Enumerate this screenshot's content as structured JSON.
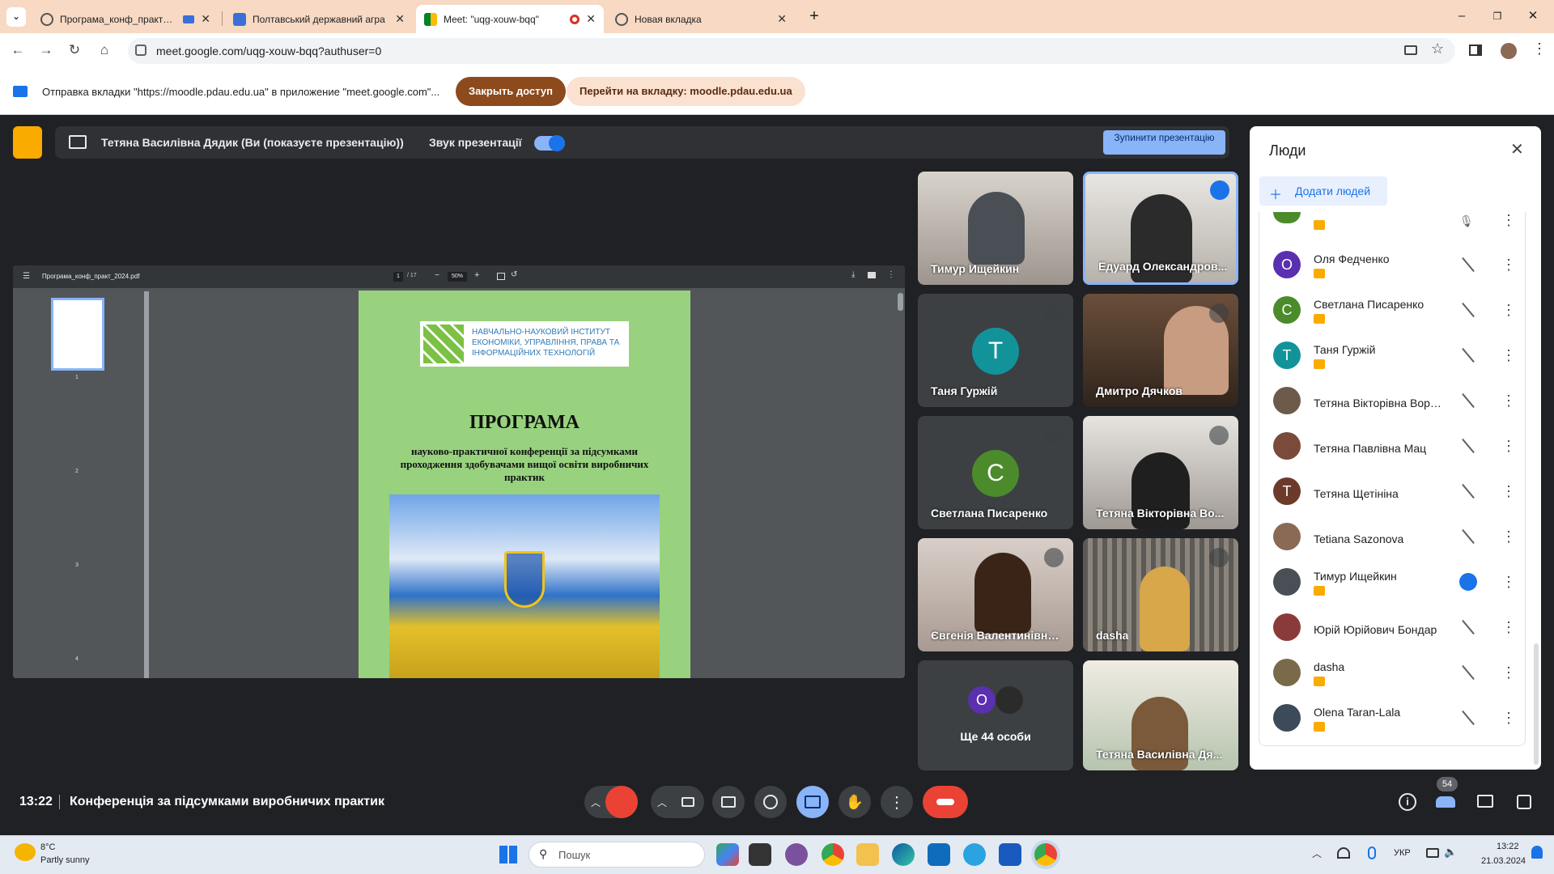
{
  "browser": {
    "tabs": [
      {
        "title": "Програма_конф_практ_20",
        "active": false
      },
      {
        "title": "Полтавський державний агра",
        "active": false
      },
      {
        "title": "Meet: \"uqg-xouw-bqq\"",
        "active": true
      },
      {
        "title": "Новая вкладка",
        "active": false
      }
    ],
    "url": "meet.google.com/uqg-xouw-bqq?authuser=0"
  },
  "infobar": {
    "text": "Отправка вкладки \"https://moodle.pdau.edu.ua\" в приложение \"meet.google.com\"...",
    "stop_label": "Закрыть доступ",
    "goto_label": "Перейти на вкладку: moodle.pdau.edu.ua"
  },
  "presenting": {
    "title": "Тетяна Василівна Дядик (Ви (показуєте презентацію))",
    "audio_label": "Звук презентації",
    "stop_label": "Зупинити презентацію"
  },
  "pdf": {
    "filename": "Програма_конф_практ_2024.pdf",
    "page": "1",
    "pages": "/ 17",
    "zoom": "50%",
    "thumbs": [
      "1",
      "2",
      "3",
      "4"
    ],
    "institute": "НАВЧАЛЬНО-НАУКОВИЙ ІНСТИТУТ ЕКОНОМІКИ, УПРАВЛІННЯ, ПРАВА ТА ІНФОРМАЦІЙНИХ ТЕХНОЛОГІЙ",
    "heading": "ПРОГРАМА",
    "subheading": "науково-практичної конференції за підсумками проходження здобувачами вищої освіти виробничих практик"
  },
  "tiles": [
    {
      "name": "Тимур Ищейкин"
    },
    {
      "name": "Едуард Олександров..."
    },
    {
      "name": "Таня Гуржій",
      "initial": "Т",
      "color": "#12939a"
    },
    {
      "name": "Дмитро Дячков"
    },
    {
      "name": "Светлана Писаренко",
      "initial": "С",
      "color": "#4c8b2b"
    },
    {
      "name": "Тетяна Вікторівна Во..."
    },
    {
      "name": "Євгенія Валентинівна..."
    },
    {
      "name": "dasha"
    },
    {
      "name": "Ще 44 особи",
      "initial": "О",
      "color": "#5a2fb0"
    },
    {
      "name": "Тетяна Василівна Дя..."
    }
  ],
  "people": {
    "title": "Люди",
    "add_label": "Додати людей",
    "count": "54",
    "rows": [
      {
        "name": "Оля Федченко",
        "initial": "О",
        "color": "#5a2fb0",
        "presenting": true
      },
      {
        "name": "Светлана Писаренко",
        "initial": "С",
        "color": "#4c8b2b",
        "presenting": true
      },
      {
        "name": "Таня Гуржій",
        "initial": "Т",
        "color": "#12939a",
        "presenting": true
      },
      {
        "name": "Тетяна Вікторівна Воро...",
        "initial": "",
        "color": "#6d5a4b",
        "presenting": false
      },
      {
        "name": "Тетяна Павлівна Мац",
        "initial": "",
        "color": "#7a4a3a",
        "presenting": false
      },
      {
        "name": "Тетяна Щетініна",
        "initial": "Т",
        "color": "#6b3a2a",
        "presenting": false
      },
      {
        "name": "Tetiana Sazonova",
        "initial": "",
        "color": "#8a6a55",
        "presenting": false
      },
      {
        "name": "Тимур Ищейкин",
        "initial": "",
        "color": "#4a4f55",
        "presenting": true
      },
      {
        "name": "Юрій Юрійович Бондар",
        "initial": "",
        "color": "#8b3a3a",
        "presenting": false
      },
      {
        "name": "dasha",
        "initial": "",
        "color": "#7b6a4a",
        "presenting": true
      },
      {
        "name": "Olena Taran-Lala",
        "initial": "",
        "color": "#3d4a5a",
        "presenting": true
      }
    ]
  },
  "bottom": {
    "time": "13:22",
    "meeting": "Конференція за підсумками виробничих практик"
  },
  "taskbar": {
    "weather_temp": "8°C",
    "weather_text": "Partly sunny",
    "search": "Пошук",
    "lang": "УКР",
    "clock_time": "13:22",
    "clock_date": "21.03.2024"
  }
}
